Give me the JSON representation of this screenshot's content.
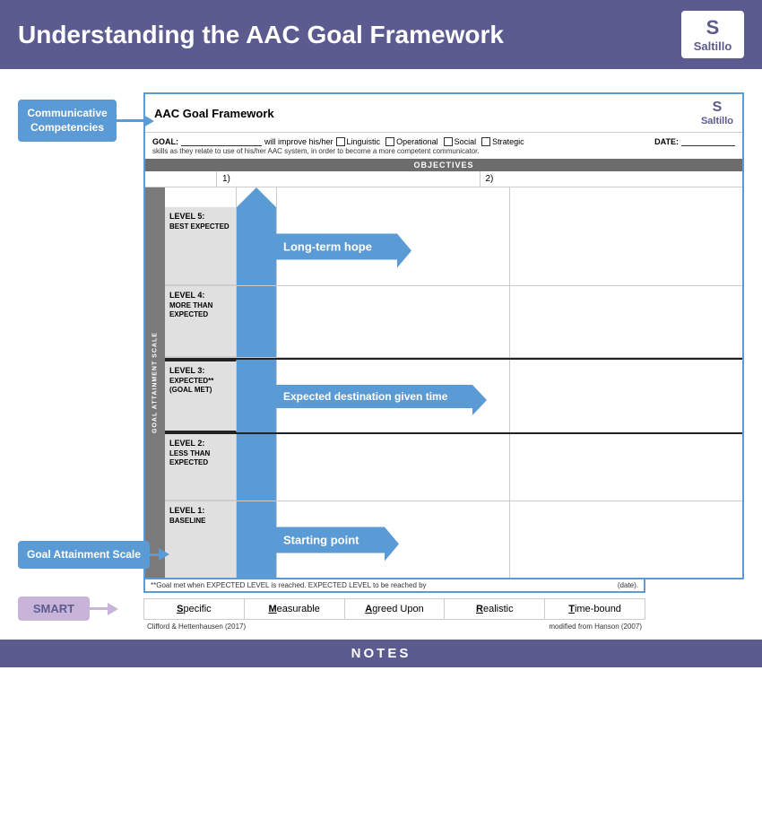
{
  "header": {
    "title": "Understanding the AAC Goal Framework",
    "logo_text": "Saltillo",
    "logo_icon": "S"
  },
  "framework": {
    "title": "AAC Goal Framework",
    "saltillo_icon": "S",
    "saltillo_text": "Saltillo",
    "goal_label": "GOAL:",
    "goal_line_text": "_________________",
    "goal_mid_text": "will improve his/her",
    "checkbox_linguistic": "Linguistic",
    "checkbox_operational": "Operational",
    "checkbox_social": "Social",
    "checkbox_strategic": "Strategic",
    "date_label": "DATE:",
    "goal_subtext": "skills as they relate to use of his/her AAC system, in order to become a more competent communicator.",
    "objectives_header": "OBJECTIVES",
    "obj_1": "1)",
    "obj_2": "2)"
  },
  "annotations": {
    "communicative_label": "Communicative Competencies",
    "gas_label": "Goal Attainment Scale",
    "smart_label": "SMART"
  },
  "gas": {
    "vertical_label": "GOAL ATTAINMENT SCALE",
    "levels": [
      {
        "id": "level5",
        "num": "LEVEL 5:",
        "desc": "BEST EXPECTED",
        "annotation": "Long-term hope",
        "has_annotation": true
      },
      {
        "id": "level4",
        "num": "LEVEL 4:",
        "desc": "MORE THAN EXPECTED",
        "has_annotation": false
      },
      {
        "id": "level3",
        "num": "LEVEL 3:",
        "desc": "EXPECTED**\n(GOAL MET)",
        "annotation": "Expected destination given time",
        "has_annotation": true,
        "is_expected": true
      },
      {
        "id": "level2",
        "num": "LEVEL 2:",
        "desc": "LESS THAN EXPECTED",
        "has_annotation": false
      },
      {
        "id": "level1",
        "num": "LEVEL 1:",
        "desc": "BASELINE",
        "annotation": "Starting point",
        "has_annotation": true
      }
    ]
  },
  "smart": {
    "footnote": "**Goal met when EXPECTED LEVEL is reached. EXPECTED LEVEL to be reached by",
    "footnote_end": "(date).",
    "columns": [
      {
        "first": "S",
        "rest": "pecific"
      },
      {
        "first": "M",
        "rest": "easurable"
      },
      {
        "first": "A",
        "rest": "greed Upon"
      },
      {
        "first": "R",
        "rest": "ealistic"
      },
      {
        "first": "T",
        "rest": "ime-bound"
      }
    ],
    "citation_left": "Clifford & Hettenhausen (2017)",
    "citation_right": "modified from Hanson (2007)"
  },
  "notes": {
    "label": "NOTES"
  }
}
